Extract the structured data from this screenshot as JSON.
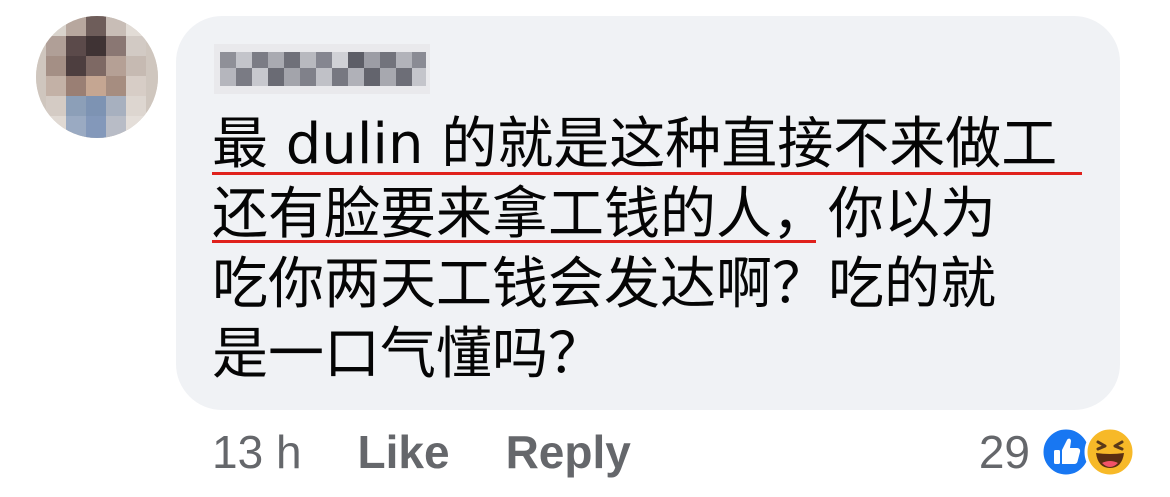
{
  "comment": {
    "lines": [
      "最 dulin 的就是这种直接不来做工",
      "还有脸要来拿工钱的人，你以为",
      "吃你两天工钱会发达啊？吃的就",
      "是一口气懂吗？"
    ]
  },
  "meta": {
    "time": "13 h",
    "like_label": "Like",
    "reply_label": "Reply"
  },
  "reactions": {
    "count": "29",
    "icons": [
      "like-icon",
      "haha-icon"
    ],
    "like_color": "#1877f2",
    "haha_color": "#f7b928"
  },
  "colors": {
    "bubble": "#f0f2f5",
    "underline": "#e0211c",
    "meta_text": "#65676b"
  }
}
